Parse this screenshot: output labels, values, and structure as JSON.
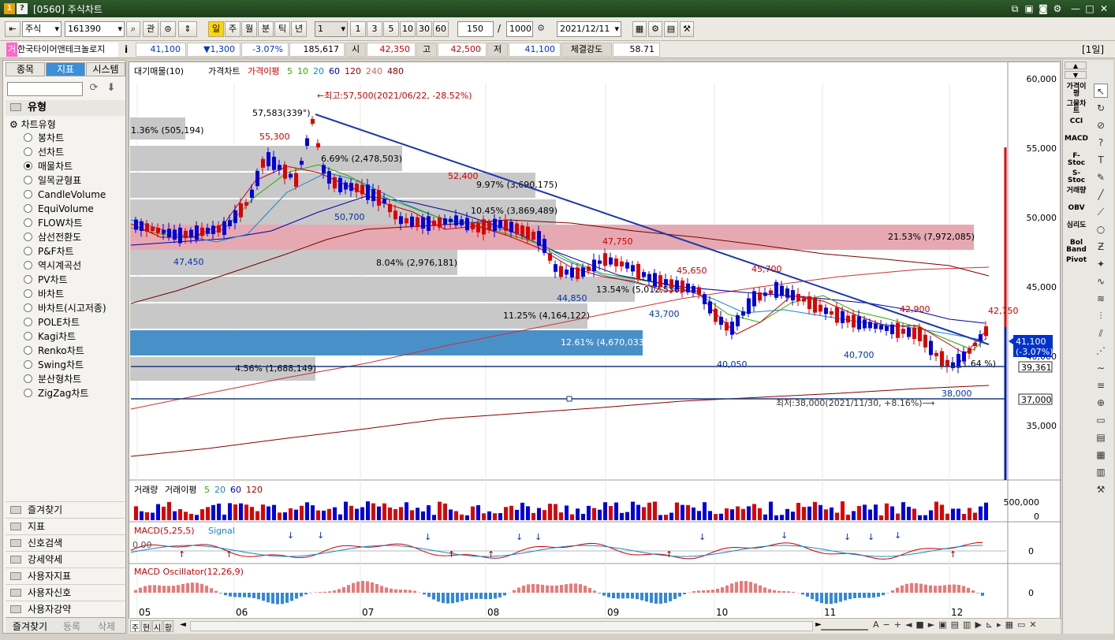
{
  "title": {
    "badge1": "1",
    "badge2": "?",
    "text": "[0560] 주식차트"
  },
  "toolbar": {
    "market": "주식",
    "code": "161390",
    "btn_gwan": "관",
    "periods": [
      "일",
      "주",
      "월",
      "분",
      "틱",
      "년"
    ],
    "unit_sel": "1",
    "quick": [
      "1",
      "3",
      "5",
      "10",
      "30",
      "60"
    ],
    "count": "150",
    "sep": "/",
    "total": "1000",
    "date": "2021/12/11"
  },
  "quote": {
    "name_prefix": "거",
    "name": "한국타이어앤테크놀로지",
    "info": "i",
    "price": "41,100",
    "change": "▼1,300",
    "rate": "-3.07%",
    "volume": "185,617",
    "open_label": "시",
    "open": "42,350",
    "high_label": "고",
    "high": "42,500",
    "low_label": "저",
    "low": "41,100",
    "strength_label": "체결강도",
    "strength": "58.71",
    "period_tag": "[1일]"
  },
  "left": {
    "tabs": [
      "종목",
      "지표",
      "시스템"
    ],
    "section": "유형",
    "tree_root": "차트유형",
    "types": [
      "봉차트",
      "선차트",
      "매물차트",
      "일목균형표",
      "CandleVolume",
      "EquiVolume",
      "FLOW차트",
      "삼선전환도",
      "P&F차트",
      "역시계곡선",
      "PV차트",
      "바차트",
      "바차트(시고저종)",
      "POLE차트",
      "Kagi차트",
      "Renko차트",
      "Swing차트",
      "분산형차트",
      "ZigZag차트"
    ],
    "selected": "매물차트",
    "folders": [
      "즐겨찾기",
      "지표",
      "신호검색",
      "강세약세",
      "사용자지표",
      "사용자신호",
      "사용자강약"
    ],
    "bottom_tabs": [
      "즐겨찾기",
      "등록",
      "삭제"
    ]
  },
  "chart": {
    "legend": {
      "items": [
        "대기매물(10)",
        "가격차트",
        "가격이평",
        "5",
        "10",
        "20",
        "60",
        "120",
        "240",
        "480"
      ],
      "colors": [
        "#000000",
        "#000000",
        "#cc0000",
        "#33aa00",
        "#33aa00",
        "#1188cc",
        "#0000aa",
        "#aa0000",
        "#cc6666",
        "#880000"
      ]
    },
    "y_ticks": [
      "60,000",
      "55,000",
      "50,000",
      "45,000",
      "40,000",
      "35,000"
    ],
    "y_values": [
      60000,
      55000,
      50000,
      45000,
      40000,
      35000
    ],
    "x_ticks": [
      "05",
      "06",
      "07",
      "08",
      "09",
      "10",
      "11",
      "12"
    ],
    "annotations": {
      "max": "←최고:57,500(2021/06/22, -28.52%)",
      "min": "최저:38,000(2021/11/30, +8.16%)⟶",
      "trend": "57,583(339°)",
      "p1": "55,300",
      "p2": "52,400",
      "p3": "47,750",
      "p4": "45,650",
      "p5": "45,700",
      "p6": "42,900",
      "p7": "42,750",
      "t1": "47,450",
      "t2": "50,700",
      "t3": "44,850",
      "t4": "43,700",
      "t5": "40,050",
      "t6": "40,700",
      "t7": "38,000"
    },
    "volume_profile": [
      {
        "label": "1.36% (505,194)",
        "color": "#c8c8c8"
      },
      {
        "label": "6.69% (2,478,503)",
        "color": "#c8c8c8"
      },
      {
        "label": "9.97% (3,690,175)",
        "color": "#c8c8c8"
      },
      {
        "label": "10.45% (3,869,489)",
        "color": "#c8c8c8"
      },
      {
        "label": "21.53% (7,972,085)",
        "color": "#e29aa4"
      },
      {
        "label": "8.04% (2,976,181)",
        "color": "#c8c8c8"
      },
      {
        "label": "13.54% (5,012,536)",
        "color": "#c8c8c8"
      },
      {
        "label": "11.25% (4,164,122)",
        "color": "#c8c8c8"
      },
      {
        "label": "12.61% (4,670,033)",
        "color": "#4a90c8"
      },
      {
        "label": "4.56% (1,688,149)",
        "color": "#c8c8c8"
      },
      {
        "label": "(1.64 %)",
        "color": "#c8c8c8"
      }
    ],
    "price_box": "41,100",
    "price_box2": "(-3.07%)",
    "line_box": "39,361",
    "line_box2": "37,000",
    "volume": {
      "legend": [
        "거래량",
        "거래이평",
        "5",
        "20",
        "60",
        "120"
      ],
      "ticks": [
        "500,000",
        "0"
      ]
    },
    "macd": {
      "legend": [
        "MACD(5,25,5)",
        "Signal"
      ],
      "zero": "0.00",
      "tick": "0"
    },
    "osc": {
      "legend": [
        "MACD Oscillator(12,26,9)"
      ],
      "tick": "0"
    }
  },
  "bottom": {
    "tabs": [
      "주",
      "현",
      "시",
      "황"
    ],
    "nav": "◄"
  },
  "right_tools": [
    "가격이평",
    "그물차트",
    "CCI",
    "MACD",
    "F-Stoc",
    "S-Stoc",
    "거래량",
    "OBV",
    "심리도",
    "Bol Band",
    "Pivot"
  ]
}
